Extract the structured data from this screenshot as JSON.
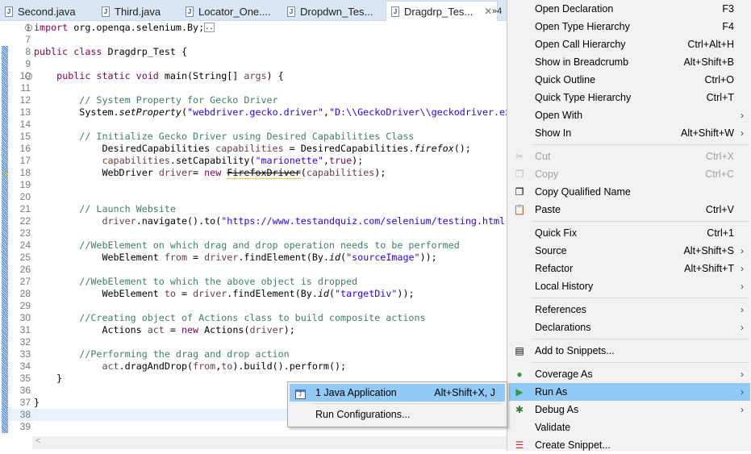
{
  "tabs": [
    {
      "label": "Second.java"
    },
    {
      "label": "Third.java"
    },
    {
      "label": "Locator_One...."
    },
    {
      "label": "Dropdwn_Tes..."
    },
    {
      "label": "Dragdrp_Tes...",
      "active": true
    }
  ],
  "tab_overflow": "»4",
  "editor": {
    "lines": [
      {
        "n": "1",
        "fold": "+",
        "segs": [
          {
            "t": "import",
            "c": "kw"
          },
          {
            "t": " org.openqa.selenium.By;"
          },
          {
            "t": "..",
            "c": "box"
          }
        ]
      },
      {
        "n": "7",
        "segs": []
      },
      {
        "n": "8",
        "segs": [
          {
            "t": "public class",
            "c": "kw"
          },
          {
            "t": " Dragdrp_Test {"
          }
        ]
      },
      {
        "n": "9",
        "segs": []
      },
      {
        "n": "10",
        "fold": "-",
        "segs": [
          {
            "t": "    "
          },
          {
            "t": "public static void",
            "c": "kw"
          },
          {
            "t": " main(String[] "
          },
          {
            "t": "args",
            "c": "lv"
          },
          {
            "t": ") {"
          }
        ]
      },
      {
        "n": "11",
        "segs": []
      },
      {
        "n": "12",
        "segs": [
          {
            "t": "        "
          },
          {
            "t": "// System Property for Gecko Driver",
            "c": "cm"
          }
        ]
      },
      {
        "n": "13",
        "segs": [
          {
            "t": "        System."
          },
          {
            "t": "setProperty",
            "c": "it"
          },
          {
            "t": "("
          },
          {
            "t": "\"webdriver.gecko.driver\"",
            "c": "str"
          },
          {
            "t": ","
          },
          {
            "t": "\"D:\\\\GeckoDriver\\\\geckodriver.exe\"",
            "c": "str"
          },
          {
            "t": ");"
          }
        ]
      },
      {
        "n": "14",
        "segs": []
      },
      {
        "n": "15",
        "segs": [
          {
            "t": "        "
          },
          {
            "t": "// Initialize Gecko Driver using Desired Capabilities Class",
            "c": "cm"
          }
        ]
      },
      {
        "n": "16",
        "segs": [
          {
            "t": "            DesiredCapabilities "
          },
          {
            "t": "capabilities",
            "c": "lv"
          },
          {
            "t": " = DesiredCapabilities."
          },
          {
            "t": "firefox",
            "c": "it"
          },
          {
            "t": "();"
          }
        ]
      },
      {
        "n": "17",
        "segs": [
          {
            "t": "            "
          },
          {
            "t": "capabilities",
            "c": "lv"
          },
          {
            "t": ".setCapability("
          },
          {
            "t": "\"marionette\"",
            "c": "str"
          },
          {
            "t": ","
          },
          {
            "t": "true",
            "c": "kw"
          },
          {
            "t": ");"
          }
        ]
      },
      {
        "n": "18",
        "warn": true,
        "segs": [
          {
            "t": "            WebDriver "
          },
          {
            "t": "driver",
            "c": "lv"
          },
          {
            "t": "= "
          },
          {
            "t": "new",
            "c": "kw"
          },
          {
            "t": " "
          },
          {
            "t": "FirefoxDriver",
            "c": "dep"
          },
          {
            "t": "("
          },
          {
            "t": "capabilities",
            "c": "lv"
          },
          {
            "t": ");"
          }
        ]
      },
      {
        "n": "19",
        "segs": []
      },
      {
        "n": "20",
        "segs": []
      },
      {
        "n": "21",
        "segs": [
          {
            "t": "        "
          },
          {
            "t": "// Launch Website",
            "c": "cm"
          }
        ]
      },
      {
        "n": "22",
        "segs": [
          {
            "t": "            "
          },
          {
            "t": "driver",
            "c": "lv"
          },
          {
            "t": ".navigate().to("
          },
          {
            "t": "\"https://www.testandquiz.com/selenium/testing.html\"",
            "c": "str"
          },
          {
            "t": ");"
          }
        ]
      },
      {
        "n": "23",
        "segs": []
      },
      {
        "n": "24",
        "segs": [
          {
            "t": "        "
          },
          {
            "t": "//WebElement on which drag and drop operation needs to be performed",
            "c": "cm"
          }
        ]
      },
      {
        "n": "25",
        "segs": [
          {
            "t": "            WebElement "
          },
          {
            "t": "from",
            "c": "lv"
          },
          {
            "t": " = "
          },
          {
            "t": "driver",
            "c": "lv"
          },
          {
            "t": ".findElement(By."
          },
          {
            "t": "id",
            "c": "it"
          },
          {
            "t": "("
          },
          {
            "t": "\"sourceImage\"",
            "c": "str"
          },
          {
            "t": "));"
          }
        ]
      },
      {
        "n": "26",
        "segs": []
      },
      {
        "n": "27",
        "segs": [
          {
            "t": "        "
          },
          {
            "t": "//WebElement to which the above object is dropped",
            "c": "cm"
          }
        ]
      },
      {
        "n": "28",
        "segs": [
          {
            "t": "            WebElement "
          },
          {
            "t": "to",
            "c": "lv"
          },
          {
            "t": " = "
          },
          {
            "t": "driver",
            "c": "lv"
          },
          {
            "t": ".findElement(By."
          },
          {
            "t": "id",
            "c": "it"
          },
          {
            "t": "("
          },
          {
            "t": "\"targetDiv\"",
            "c": "str"
          },
          {
            "t": "));"
          }
        ]
      },
      {
        "n": "29",
        "segs": []
      },
      {
        "n": "30",
        "segs": [
          {
            "t": "        "
          },
          {
            "t": "//Creating object of Actions class to build composite actions",
            "c": "cm"
          }
        ]
      },
      {
        "n": "31",
        "segs": [
          {
            "t": "            Actions "
          },
          {
            "t": "act",
            "c": "lv"
          },
          {
            "t": " = "
          },
          {
            "t": "new",
            "c": "kw"
          },
          {
            "t": " Actions("
          },
          {
            "t": "driver",
            "c": "lv"
          },
          {
            "t": ");"
          }
        ]
      },
      {
        "n": "32",
        "segs": []
      },
      {
        "n": "33",
        "segs": [
          {
            "t": "        "
          },
          {
            "t": "//Performing the drag and drop action",
            "c": "cm"
          }
        ]
      },
      {
        "n": "34",
        "segs": [
          {
            "t": "            "
          },
          {
            "t": "act",
            "c": "lv"
          },
          {
            "t": ".dragAndDrop("
          },
          {
            "t": "from",
            "c": "lv"
          },
          {
            "t": ","
          },
          {
            "t": "to",
            "c": "lv"
          },
          {
            "t": ").build().perform();"
          }
        ]
      },
      {
        "n": "35",
        "segs": [
          {
            "t": "    }"
          }
        ]
      },
      {
        "n": "36",
        "segs": []
      },
      {
        "n": "37",
        "segs": [
          {
            "t": "}"
          }
        ]
      },
      {
        "n": "38",
        "cur": true,
        "segs": []
      },
      {
        "n": "39",
        "segs": []
      }
    ]
  },
  "scroll_left": "<",
  "context_menu": {
    "groups": [
      [
        {
          "label": "Open Declaration",
          "shortcut": "F3"
        },
        {
          "label": "Open Type Hierarchy",
          "shortcut": "F4"
        },
        {
          "label": "Open Call Hierarchy",
          "shortcut": "Ctrl+Alt+H"
        },
        {
          "label": "Show in Breadcrumb",
          "shortcut": "Alt+Shift+B"
        },
        {
          "label": "Quick Outline",
          "shortcut": "Ctrl+O"
        },
        {
          "label": "Quick Type Hierarchy",
          "shortcut": "Ctrl+T"
        },
        {
          "label": "Open With",
          "submenu": true
        },
        {
          "label": "Show In",
          "shortcut": "Alt+Shift+W",
          "submenu": true
        }
      ],
      [
        {
          "label": "Cut",
          "shortcut": "Ctrl+X",
          "disabled": true,
          "icon": "scissors-icon",
          "glyph": "✂"
        },
        {
          "label": "Copy",
          "shortcut": "Ctrl+C",
          "disabled": true,
          "icon": "copy-icon",
          "glyph": "❐"
        },
        {
          "label": "Copy Qualified Name",
          "icon": "copy-qualified-icon",
          "glyph": "❐"
        },
        {
          "label": "Paste",
          "shortcut": "Ctrl+V",
          "icon": "paste-icon",
          "glyph": "📋"
        }
      ],
      [
        {
          "label": "Quick Fix",
          "shortcut": "Ctrl+1"
        },
        {
          "label": "Source",
          "shortcut": "Alt+Shift+S",
          "submenu": true
        },
        {
          "label": "Refactor",
          "shortcut": "Alt+Shift+T",
          "submenu": true
        },
        {
          "label": "Local History",
          "submenu": true
        }
      ],
      [
        {
          "label": "References",
          "submenu": true
        },
        {
          "label": "Declarations",
          "submenu": true
        }
      ],
      [
        {
          "label": "Add to Snippets...",
          "icon": "snippet-icon",
          "glyph": "▤"
        }
      ],
      [
        {
          "label": "Coverage As",
          "submenu": true,
          "icon": "coverage-icon",
          "glyph": "●",
          "color": "#2f9a3a"
        },
        {
          "label": "Run As",
          "submenu": true,
          "highlight": true,
          "icon": "run-icon",
          "glyph": "▶",
          "color": "#2f9a3a"
        },
        {
          "label": "Debug As",
          "submenu": true,
          "icon": "bug-icon",
          "glyph": "✱",
          "color": "#3a7a3a"
        },
        {
          "label": "Validate"
        },
        {
          "label": "Create Snippet...",
          "icon": "create-snippet-icon",
          "glyph": "☰",
          "color": "#c22"
        }
      ]
    ]
  },
  "submenu": {
    "items": [
      {
        "label": "1 Java Application",
        "shortcut": "Alt+Shift+X, J",
        "highlight": true
      },
      {
        "label": "Run Configurations..."
      }
    ]
  }
}
